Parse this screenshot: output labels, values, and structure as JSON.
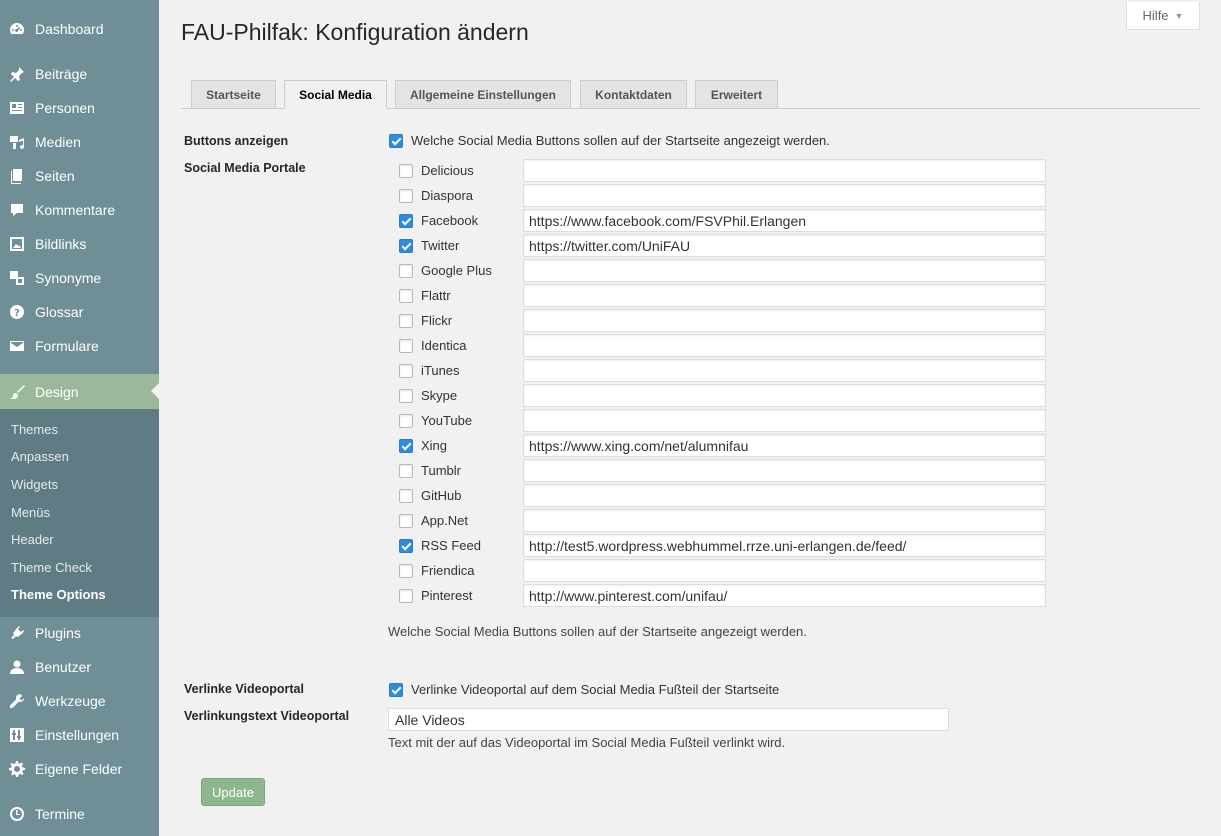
{
  "sidebar": {
    "menu": [
      {
        "label": "Dashboard",
        "icon": "dashboard-icon"
      },
      {
        "label": "Beiträge",
        "icon": "pin-icon"
      },
      {
        "label": "Personen",
        "icon": "person-card-icon"
      },
      {
        "label": "Medien",
        "icon": "media-icon"
      },
      {
        "label": "Seiten",
        "icon": "pages-icon"
      },
      {
        "label": "Kommentare",
        "icon": "comment-icon"
      },
      {
        "label": "Bildlinks",
        "icon": "image-icon"
      },
      {
        "label": "Synonyme",
        "icon": "translate-icon"
      },
      {
        "label": "Glossar",
        "icon": "help-circle-icon"
      },
      {
        "label": "Formulare",
        "icon": "mail-icon"
      },
      {
        "label": "Design",
        "icon": "brush-icon"
      },
      {
        "label": "Plugins",
        "icon": "plugin-icon"
      },
      {
        "label": "Benutzer",
        "icon": "user-icon"
      },
      {
        "label": "Werkzeuge",
        "icon": "wrench-icon"
      },
      {
        "label": "Einstellungen",
        "icon": "settings-sliders-icon"
      },
      {
        "label": "Eigene Felder",
        "icon": "gear-icon"
      },
      {
        "label": "Termine",
        "icon": "clock-icon"
      }
    ],
    "submenu": [
      "Themes",
      "Anpassen",
      "Widgets",
      "Menüs",
      "Header",
      "Theme Check",
      "Theme Options"
    ],
    "active_submenu": "Theme Options",
    "current_menu": "Design"
  },
  "help_label": "Hilfe",
  "page_title": "FAU-Philfak: Konfiguration ändern",
  "tabs": [
    "Startseite",
    "Social Media",
    "Allgemeine Einstellungen",
    "Kontaktdaten",
    "Erweitert"
  ],
  "active_tab": "Social Media",
  "buttons_anzeigen": {
    "label": "Buttons anzeigen",
    "checkbox_text": "Welche Social Media Buttons sollen auf der Startseite angezeigt werden.",
    "checked": true
  },
  "social_portale": {
    "label": "Social Media Portale",
    "portals": [
      {
        "name": "Delicious",
        "checked": false,
        "url": ""
      },
      {
        "name": "Diaspora",
        "checked": false,
        "url": ""
      },
      {
        "name": "Facebook",
        "checked": true,
        "url": "https://www.facebook.com/FSVPhil.Erlangen"
      },
      {
        "name": "Twitter",
        "checked": true,
        "url": "https://twitter.com/UniFAU"
      },
      {
        "name": "Google Plus",
        "checked": false,
        "url": ""
      },
      {
        "name": "Flattr",
        "checked": false,
        "url": ""
      },
      {
        "name": "Flickr",
        "checked": false,
        "url": ""
      },
      {
        "name": "Identica",
        "checked": false,
        "url": ""
      },
      {
        "name": "iTunes",
        "checked": false,
        "url": ""
      },
      {
        "name": "Skype",
        "checked": false,
        "url": ""
      },
      {
        "name": "YouTube",
        "checked": false,
        "url": ""
      },
      {
        "name": "Xing",
        "checked": true,
        "url": "https://www.xing.com/net/alumnifau"
      },
      {
        "name": "Tumblr",
        "checked": false,
        "url": ""
      },
      {
        "name": "GitHub",
        "checked": false,
        "url": ""
      },
      {
        "name": "App.Net",
        "checked": false,
        "url": ""
      },
      {
        "name": "RSS Feed",
        "checked": true,
        "url": "http://test5.wordpress.webhummel.rrze.uni-erlangen.de/feed/"
      },
      {
        "name": "Friendica",
        "checked": false,
        "url": ""
      },
      {
        "name": "Pinterest",
        "checked": false,
        "url": "http://www.pinterest.com/unifau/"
      }
    ],
    "description": "Welche Social Media Buttons sollen auf der Startseite angezeigt werden."
  },
  "videoportal": {
    "label": "Verlinke Videoportal",
    "checkbox_text": "Verlinke Videoportal auf dem Social Media Fußteil der Startseite",
    "checked": true
  },
  "videotext": {
    "label": "Verlinkungstext Videoportal",
    "value": "Alle Videos",
    "description": "Text mit der auf das Videoportal im Social Media Fußteil verlinkt wird."
  },
  "update_label": "Update",
  "colors": {
    "sidebar_bg": "#6f8e96",
    "submenu_bg": "#5f7b84",
    "current_menu_bg": "#9bb99a",
    "checkbox_blue": "#2e8cdb",
    "update_button": "#8fb78e"
  }
}
